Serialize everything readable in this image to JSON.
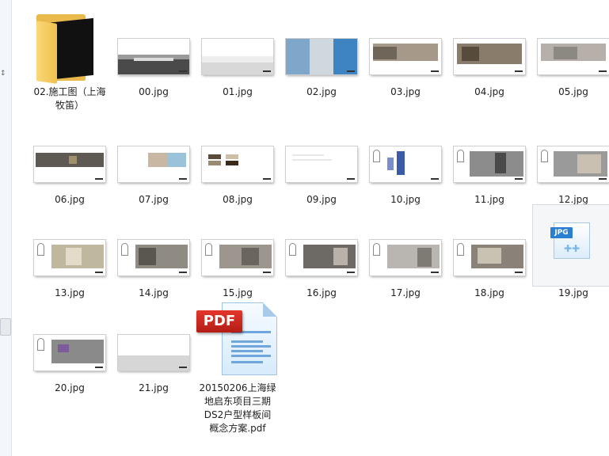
{
  "navigation": {
    "collapsed_glyph": "↕"
  },
  "files": [
    {
      "name": "02.施工图（上海牧笛）",
      "type": "folder",
      "label_lines": [
        "02.施工图（上海",
        "牧笛）"
      ]
    },
    {
      "name": "00.jpg",
      "type": "jpg"
    },
    {
      "name": "01.jpg",
      "type": "jpg"
    },
    {
      "name": "02.jpg",
      "type": "jpg"
    },
    {
      "name": "03.jpg",
      "type": "jpg"
    },
    {
      "name": "04.jpg",
      "type": "jpg"
    },
    {
      "name": "05.jpg",
      "type": "jpg"
    },
    {
      "name": "06.jpg",
      "type": "jpg"
    },
    {
      "name": "07.jpg",
      "type": "jpg"
    },
    {
      "name": "08.jpg",
      "type": "jpg"
    },
    {
      "name": "09.jpg",
      "type": "jpg"
    },
    {
      "name": "10.jpg",
      "type": "jpg"
    },
    {
      "name": "11.jpg",
      "type": "jpg"
    },
    {
      "name": "12.jpg",
      "type": "jpg"
    },
    {
      "name": "13.jpg",
      "type": "jpg"
    },
    {
      "name": "14.jpg",
      "type": "jpg"
    },
    {
      "name": "15.jpg",
      "type": "jpg"
    },
    {
      "name": "16.jpg",
      "type": "jpg"
    },
    {
      "name": "17.jpg",
      "type": "jpg"
    },
    {
      "name": "18.jpg",
      "type": "jpg"
    },
    {
      "name": "19.jpg",
      "type": "jpg",
      "generic_icon": true,
      "icon_tag": "JPG",
      "selected": true
    },
    {
      "name": "20.jpg",
      "type": "jpg"
    },
    {
      "name": "21.jpg",
      "type": "jpg"
    },
    {
      "name": "20150206上海绿地启东项目三期DS2户型样板间概念方案.pdf",
      "type": "pdf",
      "icon_tag": "PDF",
      "label_lines": [
        "20150206上海绿",
        "地启东项目三期",
        "DS2户型样板间",
        "概念方案.pdf"
      ]
    }
  ]
}
